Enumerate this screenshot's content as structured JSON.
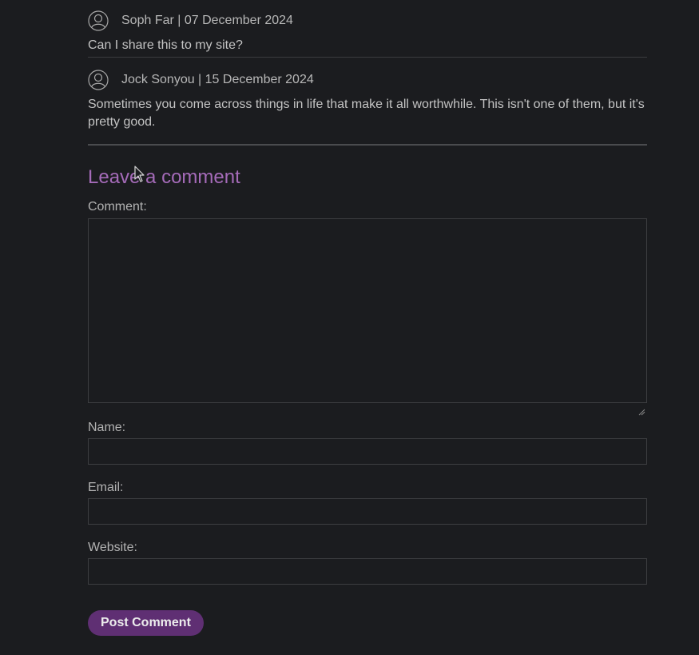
{
  "comments": [
    {
      "author": "Soph Far",
      "date": "07 December 2024",
      "meta": "Soph Far | 07 December 2024",
      "text": "Can I share this to my site?"
    },
    {
      "author": "Jock Sonyou",
      "date": "15 December 2024",
      "meta": "Jock Sonyou | 15 December 2024",
      "text": "Sometimes you come across things in life that make it all worthwhile. This isn't one of them, but it's pretty good."
    }
  ],
  "form": {
    "title": "Leave a comment",
    "comment_label": "Comment:",
    "comment_value": "",
    "name_label": "Name:",
    "name_value": "",
    "email_label": "Email:",
    "email_value": "",
    "website_label": "Website:",
    "website_value": "",
    "submit_label": "Post Comment"
  },
  "colors": {
    "background": "#1b1c1f",
    "accent_title": "#a56bb9",
    "button": "#5f2f73"
  },
  "icons": {
    "avatar": "user-avatar-icon",
    "cursor": "mouse-pointer-icon"
  }
}
